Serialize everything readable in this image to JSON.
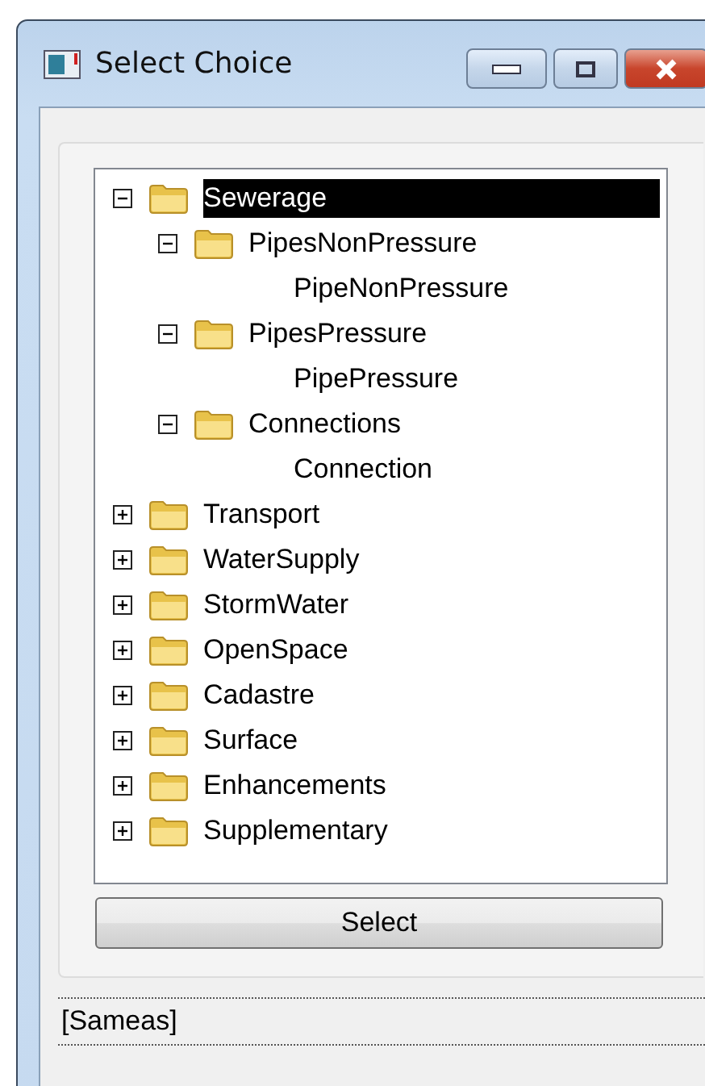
{
  "window": {
    "title": "Select Choice"
  },
  "tree": [
    {
      "label": "Sewerage",
      "kind": "folder",
      "expanded": true,
      "selected": true,
      "children": [
        {
          "label": "PipesNonPressure",
          "kind": "folder",
          "expanded": true,
          "selected": false,
          "children": [
            {
              "label": "PipeNonPressure",
              "kind": "item",
              "selected": false
            }
          ]
        },
        {
          "label": "PipesPressure",
          "kind": "folder",
          "expanded": true,
          "selected": false,
          "children": [
            {
              "label": "PipePressure",
              "kind": "item",
              "selected": false
            }
          ]
        },
        {
          "label": "Connections",
          "kind": "folder",
          "expanded": true,
          "selected": false,
          "children": [
            {
              "label": "Connection",
              "kind": "item",
              "selected": false
            }
          ]
        }
      ]
    },
    {
      "label": "Transport",
      "kind": "folder",
      "expanded": false,
      "selected": false
    },
    {
      "label": "WaterSupply",
      "kind": "folder",
      "expanded": false,
      "selected": false
    },
    {
      "label": "StormWater",
      "kind": "folder",
      "expanded": false,
      "selected": false
    },
    {
      "label": "OpenSpace",
      "kind": "folder",
      "expanded": false,
      "selected": false
    },
    {
      "label": "Cadastre",
      "kind": "folder",
      "expanded": false,
      "selected": false
    },
    {
      "label": "Surface",
      "kind": "folder",
      "expanded": false,
      "selected": false
    },
    {
      "label": "Enhancements",
      "kind": "folder",
      "expanded": false,
      "selected": false
    },
    {
      "label": "Supplementary",
      "kind": "folder",
      "expanded": false,
      "selected": false
    }
  ],
  "button": {
    "label": "Select"
  },
  "status_bar": {
    "text": "[Sameas]"
  }
}
